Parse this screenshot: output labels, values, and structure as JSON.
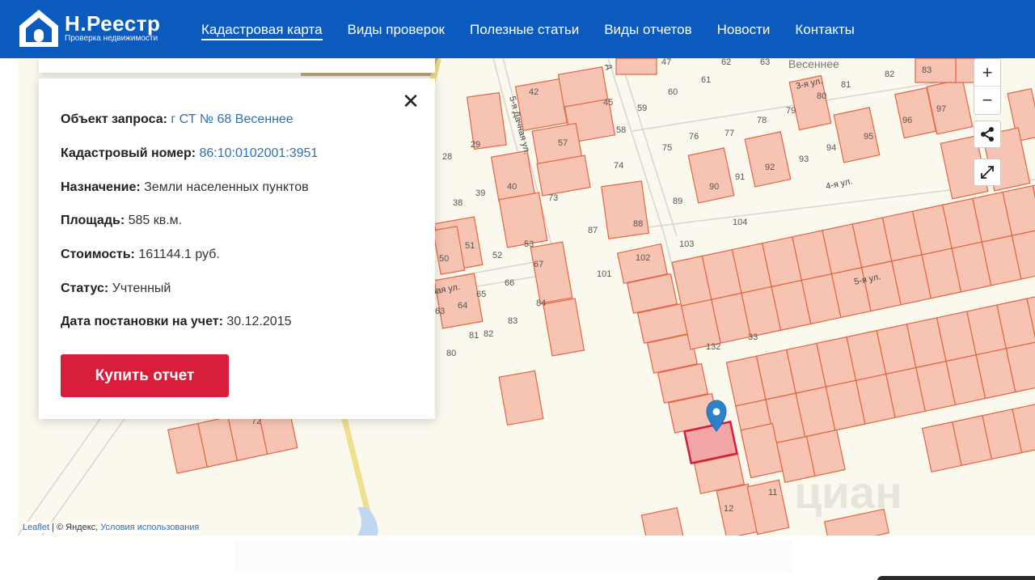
{
  "header": {
    "logo_title": "Н.Реестр",
    "logo_subtitle": "Проверка недвижимости",
    "nav": [
      {
        "label": "Кадастровая карта",
        "active": true
      },
      {
        "label": "Виды проверок",
        "active": false
      },
      {
        "label": "Полезные статьи",
        "active": false
      },
      {
        "label": "Виды отчетов",
        "active": false
      },
      {
        "label": "Новости",
        "active": false
      },
      {
        "label": "Контакты",
        "active": false
      }
    ]
  },
  "card": {
    "rows": [
      {
        "key": "Объект запроса:",
        "value": "г СТ № 68 Весеннее",
        "link": true
      },
      {
        "key": "Кадастровый номер:",
        "value": "86:10:0102001:3951",
        "link": true
      },
      {
        "key": "Назначение:",
        "value": "Земли населенных пунктов",
        "link": false
      },
      {
        "key": "Площадь:",
        "value": "585 кв.м.",
        "link": false
      },
      {
        "key": "Стоимость:",
        "value": "161144.1 руб.",
        "link": false
      },
      {
        "key": "Статус:",
        "value": "Учтенный",
        "link": false
      },
      {
        "key": "Дата постановки на учет:",
        "value": "30.12.2015",
        "link": false
      }
    ],
    "buy_label": "Купить отчет",
    "close_glyph": "✕"
  },
  "map": {
    "zoom_in": "+",
    "zoom_out": "−",
    "attribution": {
      "leaflet": "Leaflet",
      "yandex": "| © Яндекс,",
      "terms": "Условия использования"
    },
    "place_label": "Весеннее",
    "streets": [
      "5-я Дачная ул.",
      "3-я ул.",
      "4-я ул.",
      "5-я ул.",
      "ная ул.",
      "д"
    ],
    "watermark": "циан",
    "plot_numbers": [
      "47",
      "62",
      "63",
      "81",
      "82",
      "83",
      "61",
      "60",
      "42",
      "45",
      "59",
      "80",
      "97",
      "96",
      "78",
      "79",
      "29",
      "28",
      "57",
      "58",
      "76",
      "77",
      "75",
      "74",
      "94",
      "95",
      "92",
      "93",
      "90",
      "91",
      "40",
      "39",
      "38",
      "73",
      "89",
      "88",
      "87",
      "104",
      "4-я",
      "51",
      "50",
      "52",
      "53",
      "103",
      "102",
      "101",
      "67",
      "66",
      "65",
      "64",
      "63",
      "84",
      "83",
      "82",
      "81",
      "80",
      "33",
      "132",
      "72",
      "11",
      "12"
    ],
    "colors": {
      "plot_fill": "#f7c4b4",
      "plot_stroke": "#e2653f",
      "selected_stroke": "#d0203a",
      "selected_fill": "#f4a6a6",
      "marker": "#2b82cb",
      "road": "#c9c9c9"
    }
  }
}
